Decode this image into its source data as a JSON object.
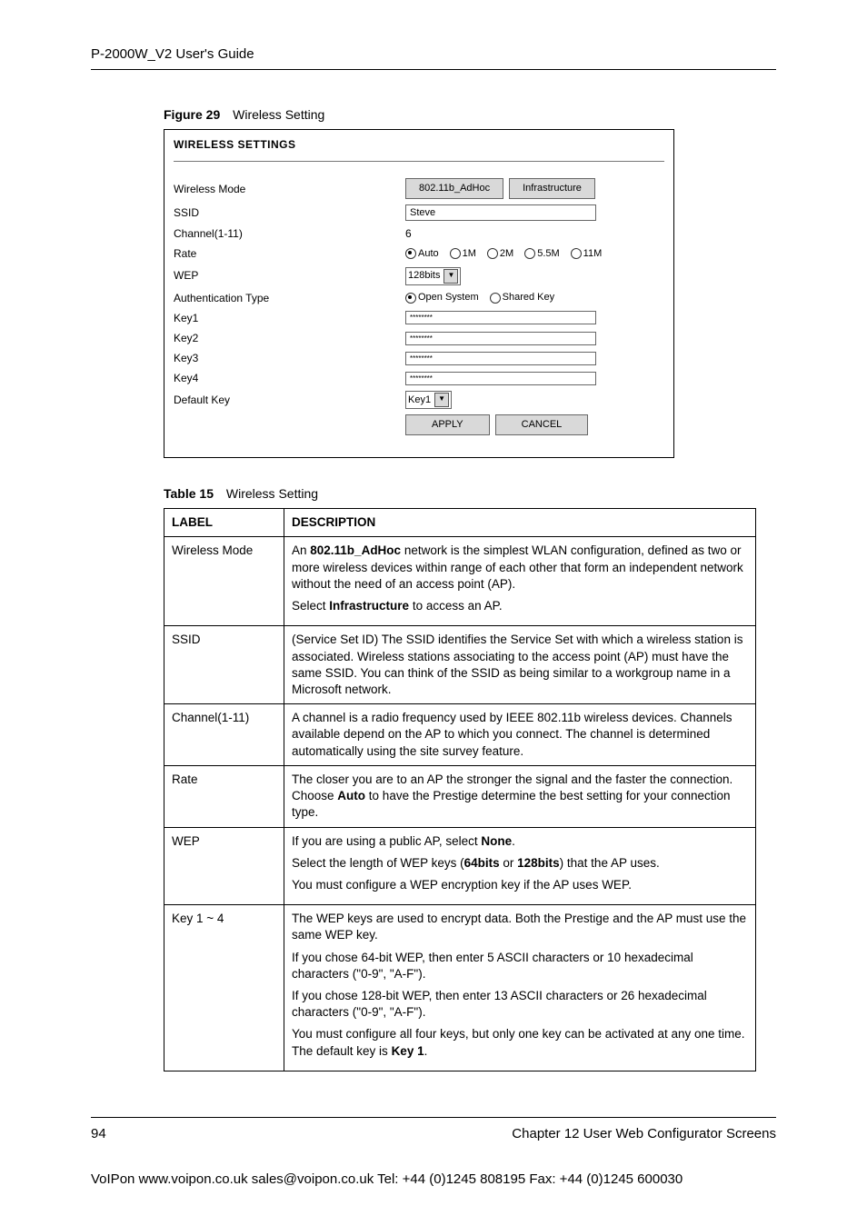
{
  "header": {
    "title": "P-2000W_V2 User's Guide"
  },
  "figure": {
    "label": "Figure 29",
    "caption": "Wireless Setting"
  },
  "panel": {
    "heading": "WIRELESS SETTINGS",
    "rows": {
      "wireless_mode": {
        "label": "Wireless Mode",
        "btn_adhoc": "802.11b_AdHoc",
        "btn_infra": "Infrastructure"
      },
      "ssid": {
        "label": "SSID",
        "value": "Steve"
      },
      "channel": {
        "label": "Channel(1-11)",
        "value": "6"
      },
      "rate": {
        "label": "Rate",
        "options": [
          {
            "label": "Auto",
            "selected": true
          },
          {
            "label": "1M",
            "selected": false
          },
          {
            "label": "2M",
            "selected": false
          },
          {
            "label": "5.5M",
            "selected": false
          },
          {
            "label": "11M",
            "selected": false
          }
        ]
      },
      "wep": {
        "label": "WEP",
        "value": "128bits"
      },
      "auth": {
        "label": "Authentication Type",
        "options": [
          {
            "label": "Open System",
            "selected": true
          },
          {
            "label": "Shared Key",
            "selected": false
          }
        ]
      },
      "key1": {
        "label": "Key1",
        "value": "********"
      },
      "key2": {
        "label": "Key2",
        "value": "********"
      },
      "key3": {
        "label": "Key3",
        "value": "********"
      },
      "key4": {
        "label": "Key4",
        "value": "********"
      },
      "default_key": {
        "label": "Default Key",
        "value": "Key1"
      },
      "apply": "APPLY",
      "cancel": "CANCEL"
    }
  },
  "table": {
    "label": "Table 15",
    "caption": "Wireless Setting",
    "col_label": "LABEL",
    "col_desc": "DESCRIPTION",
    "rows": [
      {
        "label": "Wireless Mode",
        "desc_html": "An <b>802.11b_AdHoc</b> network is the simplest WLAN configuration, defined as two or more wireless devices within range of each other that form an independent network without the need of an access point (AP).<p>Select <b>Infrastructure</b> to access an AP.</p>"
      },
      {
        "label": "SSID",
        "desc_html": "(Service Set ID) The SSID identifies the Service Set with which a wireless station is associated. Wireless stations associating to the access point (AP) must have the same SSID. You can think of the SSID as being similar to a workgroup name in a Microsoft network."
      },
      {
        "label": "Channel(1-11)",
        "desc_html": "A channel is a radio frequency used by IEEE 802.11b wireless devices. Channels available depend on the AP to which you connect. The channel is determined automatically using the site survey feature."
      },
      {
        "label": "Rate",
        "desc_html": "The closer you are to an AP the stronger the signal and the faster the connection. Choose <b>Auto</b> to have the Prestige determine the best setting for your connection type."
      },
      {
        "label": "WEP",
        "desc_html": "If you are using a public AP, select <b>None</b>.<p>Select the length of WEP keys (<b>64bits</b> or <b>128bits</b>) that the AP uses.</p><p>You must configure a WEP encryption key if the AP uses WEP.</p>"
      },
      {
        "label": "Key 1 ~ 4",
        "desc_html": "The WEP keys are used to encrypt data. Both the Prestige and the AP must use the same WEP key.<p>If you chose 64-bit WEP, then enter 5 ASCII characters or 10 hexadecimal characters (\"0-9\", \"A-F\").</p><p>If you chose 128-bit WEP, then enter 13 ASCII characters or 26 hexadecimal characters (\"0-9\", \"A-F\").</p><p>You must configure all four keys, but only one key can be activated at any one time. The default key is <b>Key 1</b>.</p>"
      }
    ]
  },
  "footer": {
    "page_no": "94",
    "chapter": "Chapter 12 User Web Configurator Screens",
    "bottom": "VoIPon   www.voipon.co.uk   sales@voipon.co.uk   Tel: +44 (0)1245 808195   Fax: +44 (0)1245 600030"
  }
}
